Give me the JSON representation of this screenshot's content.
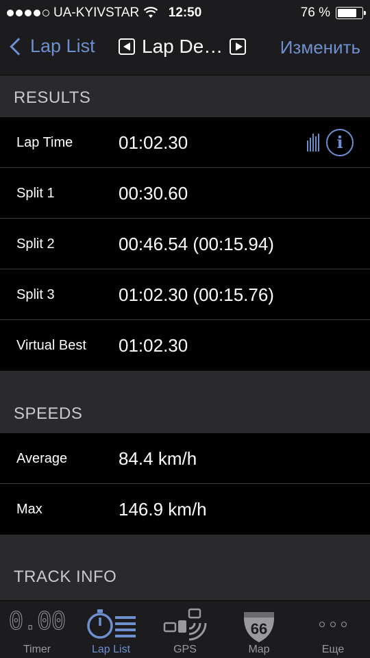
{
  "status_bar": {
    "carrier": "UA-KYIVSTAR",
    "time": "12:50",
    "battery": "76 %",
    "signal_bars": 4,
    "signal_bars_total": 5,
    "battery_level": 0.76
  },
  "nav": {
    "back_label": "Lap List",
    "title": "Lap De…",
    "edit_label": "Изменить"
  },
  "colors": {
    "accent": "#6e8fd0",
    "background": "#000000",
    "section_bg": "#2a2a2c"
  },
  "results": {
    "header": "RESULTS",
    "rows": [
      {
        "label": "Lap Time",
        "value": "01:02.30"
      },
      {
        "label": "Split 1",
        "value": "00:30.60"
      },
      {
        "label": "Split 2",
        "value": "00:46.54 (00:15.94)"
      },
      {
        "label": "Split 3",
        "value": "01:02.30 (00:15.76)"
      },
      {
        "label": "Virtual Best",
        "value": "01:02.30"
      }
    ]
  },
  "speeds": {
    "header": "SPEEDS",
    "rows": [
      {
        "label": "Average",
        "value": "84.4 km/h"
      },
      {
        "label": "Max",
        "value": "146.9 km/h"
      }
    ]
  },
  "track_info": {
    "header": "TRACK INFO"
  },
  "tabbar": {
    "tabs": [
      {
        "label": "Timer",
        "icon": "timer-digits-icon",
        "glyph": "0.00"
      },
      {
        "label": "Lap List",
        "icon": "stopwatch-list-icon"
      },
      {
        "label": "GPS",
        "icon": "satellite-icon"
      },
      {
        "label": "Map",
        "icon": "route-66-sign-icon",
        "glyph": "66"
      },
      {
        "label": "Еще",
        "icon": "more-icon"
      }
    ]
  }
}
